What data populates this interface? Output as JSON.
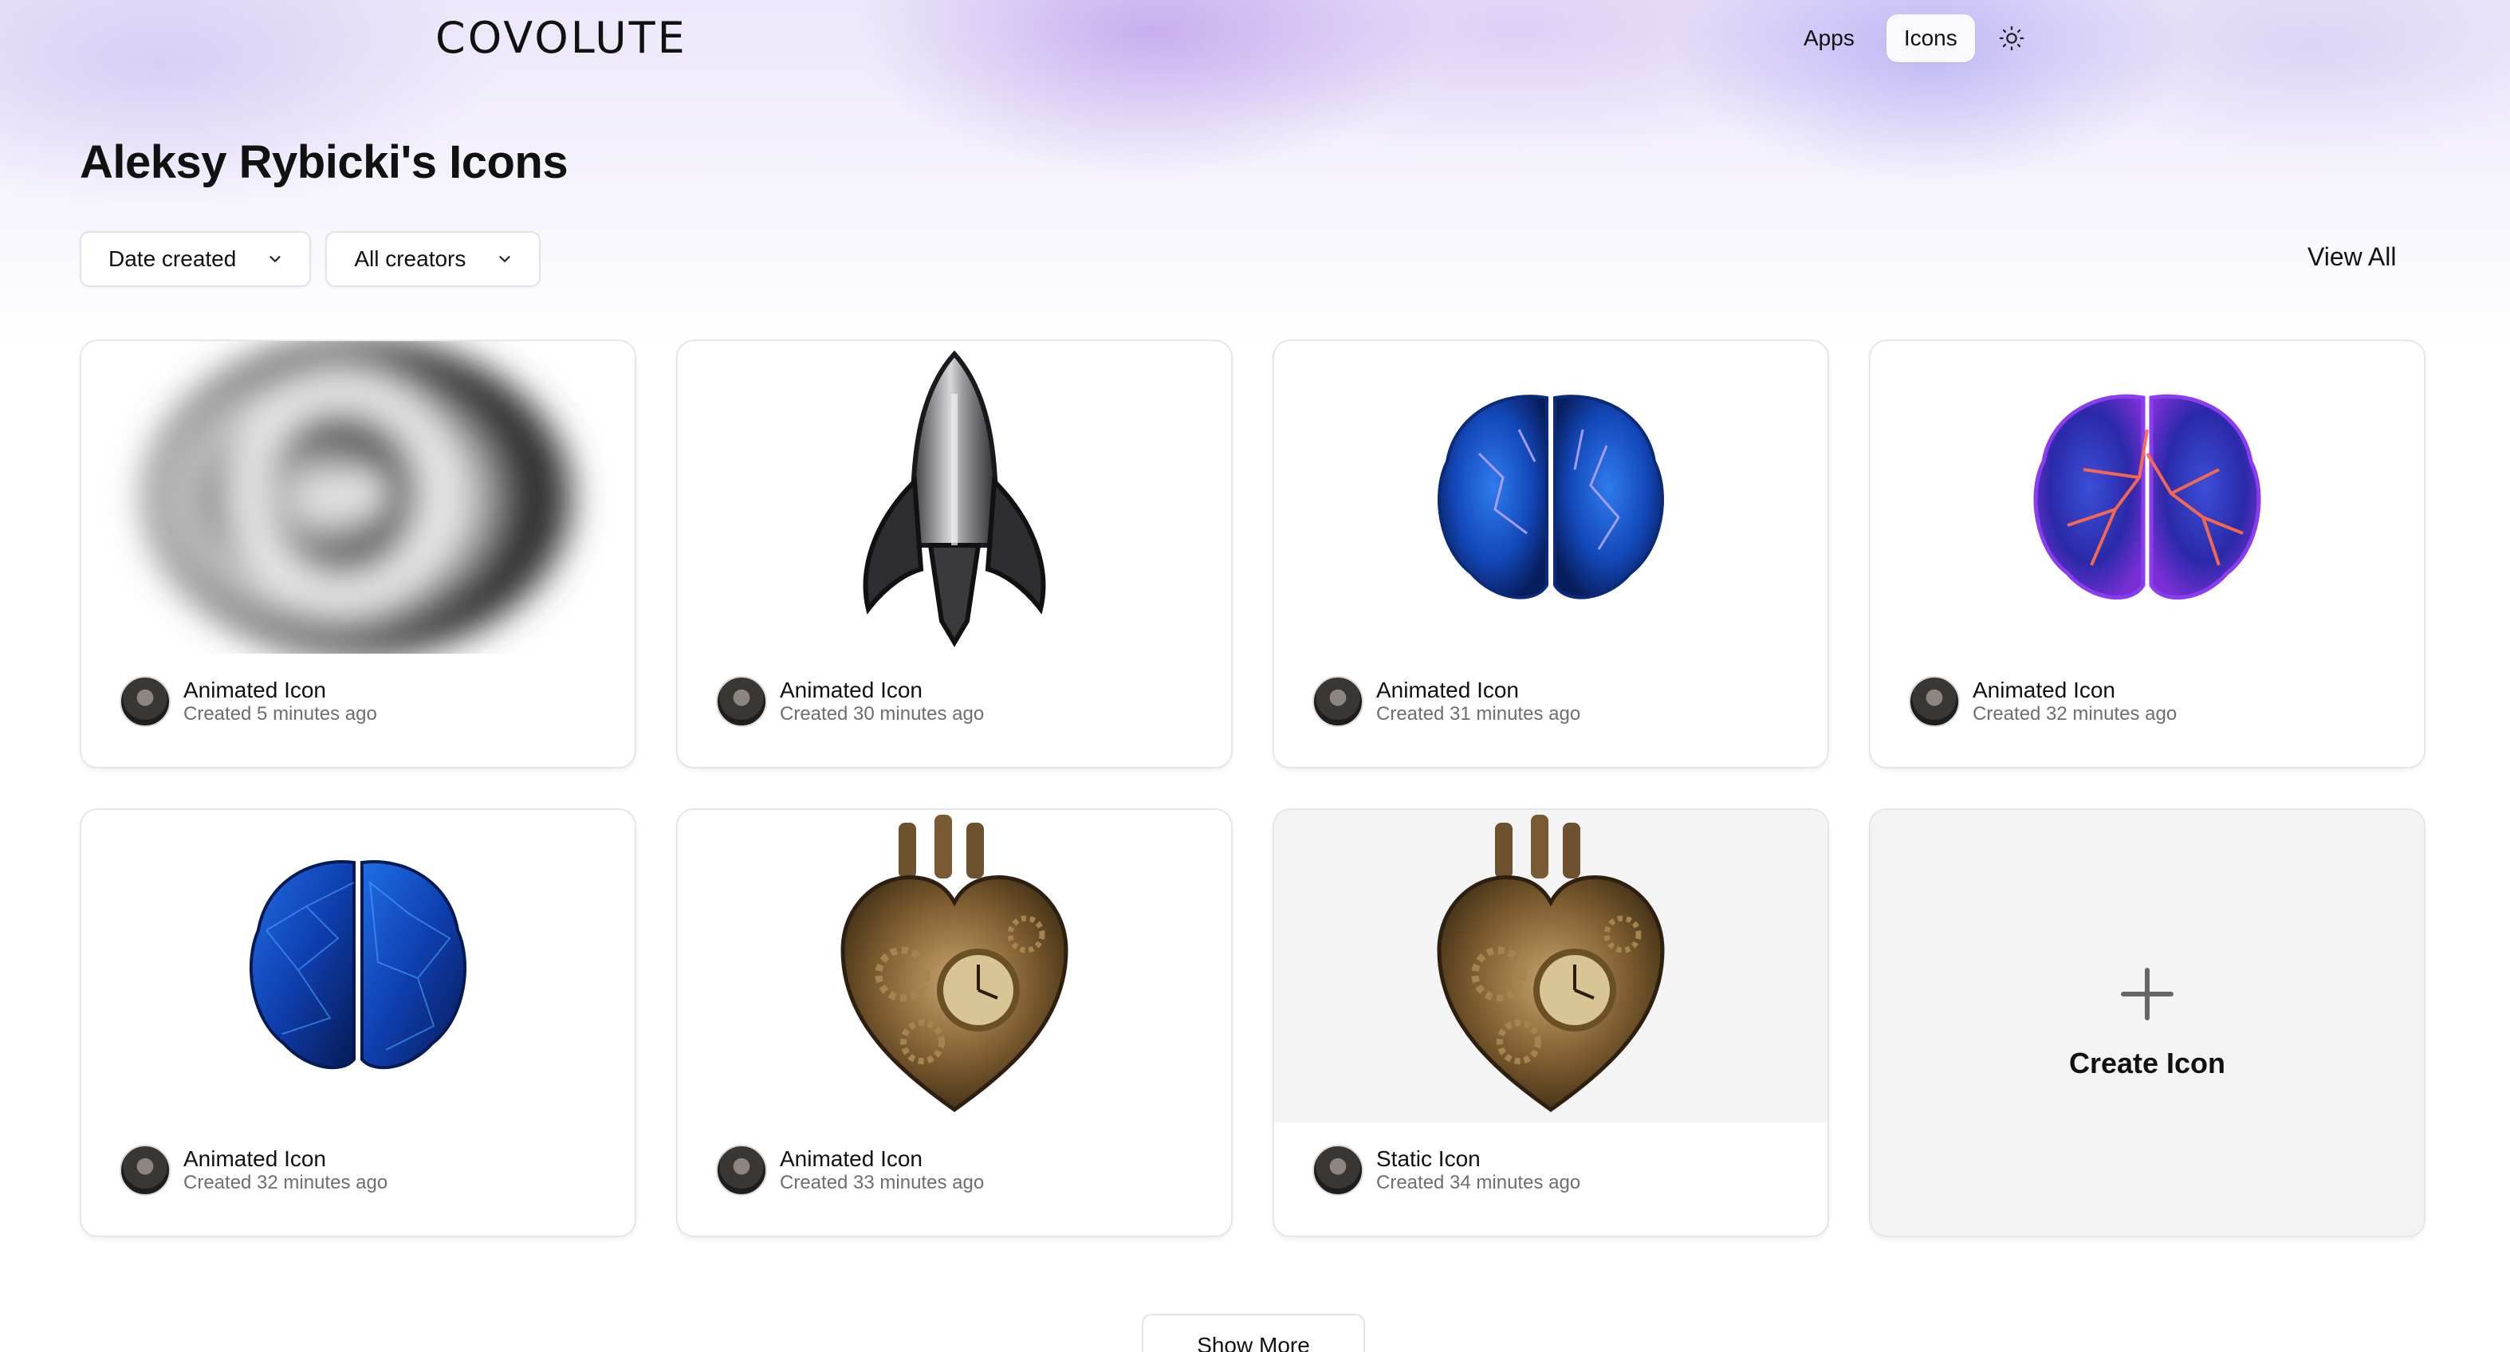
{
  "app": {
    "logo_text": "COVOLUTE",
    "nav": [
      {
        "label": "Apps",
        "active": false
      },
      {
        "label": "Icons",
        "active": true
      }
    ],
    "theme_icon": "sun-icon"
  },
  "page": {
    "title": "Aleksy Rybicki's Icons",
    "filters": {
      "sort": {
        "selected": "Date created",
        "icon": "chevron-down-icon"
      },
      "creator": {
        "selected": "All creators",
        "icon": "chevron-down-icon"
      }
    },
    "view_all_label": "View All"
  },
  "icons": [
    {
      "title": "Animated Icon",
      "created": "Created 5 minutes ago",
      "image": "blurred-eye-swirl"
    },
    {
      "title": "Animated Icon",
      "created": "Created 30 minutes ago",
      "image": "metal-rocket"
    },
    {
      "title": "Animated Icon",
      "created": "Created 31 minutes ago",
      "image": "blue-crystal-brain-lightning"
    },
    {
      "title": "Animated Icon",
      "created": "Created 32 minutes ago",
      "image": "purple-brain-red-lightning"
    },
    {
      "title": "Animated Icon",
      "created": "Created 32 minutes ago",
      "image": "blue-low-poly-brain"
    },
    {
      "title": "Animated Icon",
      "created": "Created 33 minutes ago",
      "image": "steampunk-heart"
    },
    {
      "title": "Static Icon",
      "created": "Created 34 minutes ago",
      "image": "steampunk-heart"
    }
  ],
  "create_card": {
    "label": "Create Icon",
    "icon": "plus-icon"
  },
  "show_more_label": "Show More",
  "colors": {
    "accent_glow": "#b49cf0",
    "card_border": "#e6e6ea",
    "muted_text": "#6d6d73",
    "create_bg": "#f4f4f5"
  }
}
